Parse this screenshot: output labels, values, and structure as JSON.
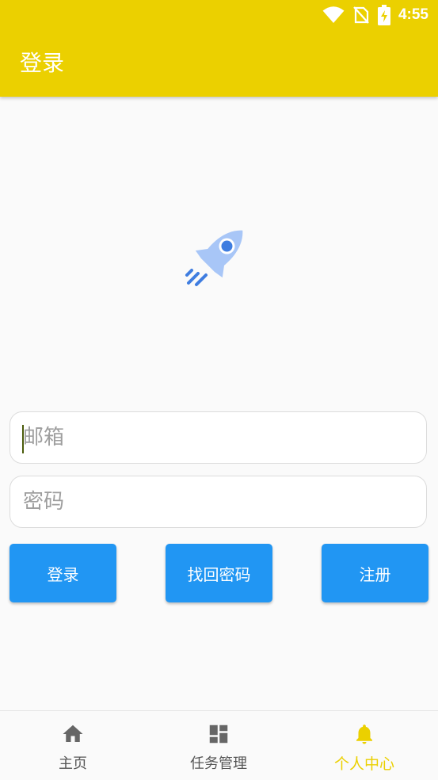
{
  "status_bar": {
    "time": "4:55",
    "icons": [
      "wifi-icon",
      "no-sim-icon",
      "battery-charging-icon"
    ]
  },
  "app_bar": {
    "title": "登录"
  },
  "logo": {
    "icon": "rocket-icon"
  },
  "form": {
    "email_placeholder": "邮箱",
    "password_placeholder": "密码"
  },
  "buttons": {
    "login": "登录",
    "forgot_password": "找回密码",
    "register": "注册"
  },
  "bottom_nav": {
    "items": [
      {
        "label": "主页",
        "icon": "home-icon",
        "active": false
      },
      {
        "label": "任务管理",
        "icon": "dashboard-icon",
        "active": false
      },
      {
        "label": "个人中心",
        "icon": "bell-icon",
        "active": true
      }
    ]
  },
  "colors": {
    "app_bar": "#ebd000",
    "button": "#2196f3",
    "active_nav": "#ebd000",
    "inactive_nav": "#555555",
    "rocket": "#a8c6f7",
    "rocket_accent": "#3f7de0"
  }
}
